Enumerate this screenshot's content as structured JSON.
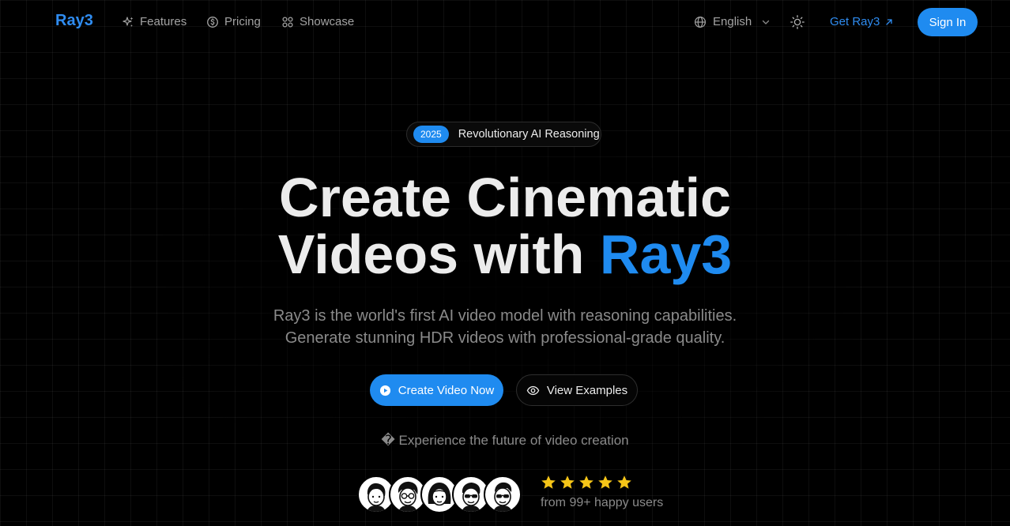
{
  "header": {
    "brand": "Ray3",
    "nav": [
      {
        "label": "Features",
        "icon": "sparkles-icon"
      },
      {
        "label": "Pricing",
        "icon": "coin-icon"
      },
      {
        "label": "Showcase",
        "icon": "grid-icon"
      }
    ],
    "language": "English",
    "get_label": "Get Ray3",
    "signin_label": "Sign In"
  },
  "hero": {
    "badge_year": "2025",
    "badge_text": "Revolutionary AI Reasoning",
    "title_line1": "Create Cinematic",
    "title_line2_prefix": "Videos with ",
    "title_line2_accent": "Ray3",
    "subtitle_line1": "Ray3 is the world's first AI video model with reasoning capabilities.",
    "subtitle_line2": "Generate stunning HDR videos with professional-grade quality.",
    "primary_cta": "Create Video Now",
    "secondary_cta": "View Examples",
    "tagline": "� Experience the future of video creation",
    "rating_stars": 5,
    "social_proof": "from 99+ happy users"
  },
  "colors": {
    "accent": "#1f8bf0",
    "background": "#000000",
    "star": "#f5c518"
  }
}
